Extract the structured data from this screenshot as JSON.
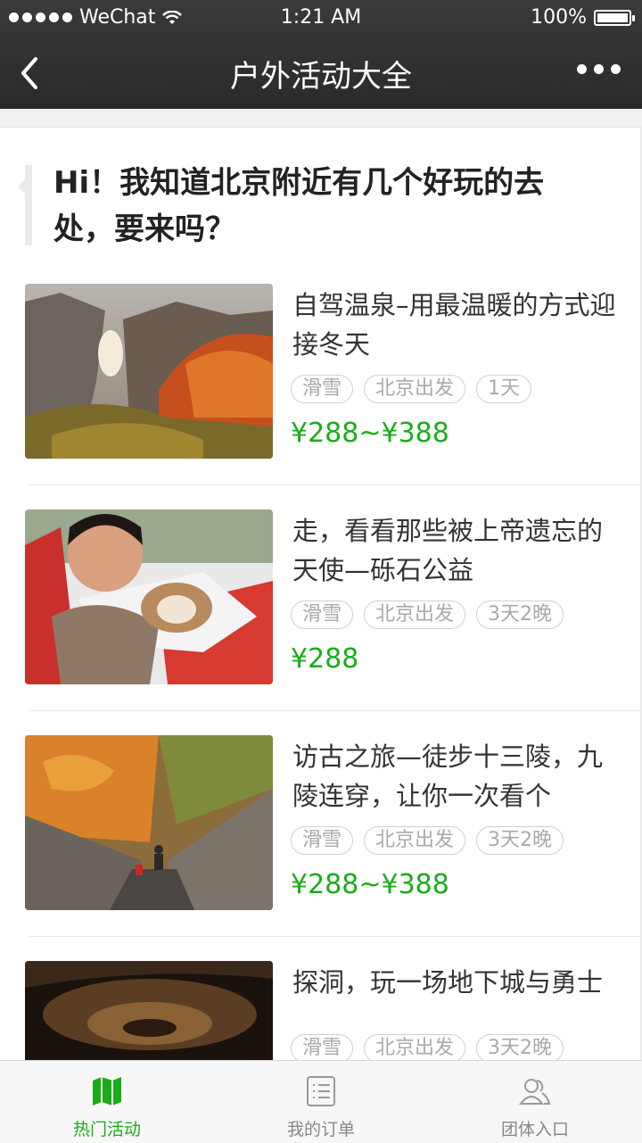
{
  "status": {
    "carrier": "WeChat",
    "time": "1:21 AM",
    "battery": "100%",
    "battery_level": 1.0
  },
  "nav": {
    "title": "户外活动大全",
    "back_icon": "chevron-left-icon",
    "more_icon": "more-dots-icon"
  },
  "greeting": "Hi！我知道北京附近有几个好玩的去处，要来吗？",
  "items": [
    {
      "title": "自驾温泉–用最温暖的方式迎接冬天",
      "tags": [
        "滑雪",
        "北京出发",
        "1天"
      ],
      "price": "¥288~¥388"
    },
    {
      "title": "走，看看那些被上帝遗忘的天使—砾石公益",
      "tags": [
        "滑雪",
        "北京出发",
        "3天2晚"
      ],
      "price": "¥288"
    },
    {
      "title": "访古之旅—徒步十三陵，九陵连穿，让你一次看个",
      "tags": [
        "滑雪",
        "北京出发",
        "3天2晚"
      ],
      "price": "¥288~¥388"
    },
    {
      "title": "探洞，玩一场地下城与勇士",
      "tags": [
        "滑雪",
        "北京出发",
        "3天2晚"
      ],
      "price": ""
    }
  ],
  "tabs": [
    {
      "label": "热门活动",
      "icon": "map-icon"
    },
    {
      "label": "我的订单",
      "icon": "list-icon"
    },
    {
      "label": "团体入口",
      "icon": "group-icon"
    }
  ],
  "colors": {
    "accent": "#1aad19",
    "navbar": "#2f2f2f"
  }
}
